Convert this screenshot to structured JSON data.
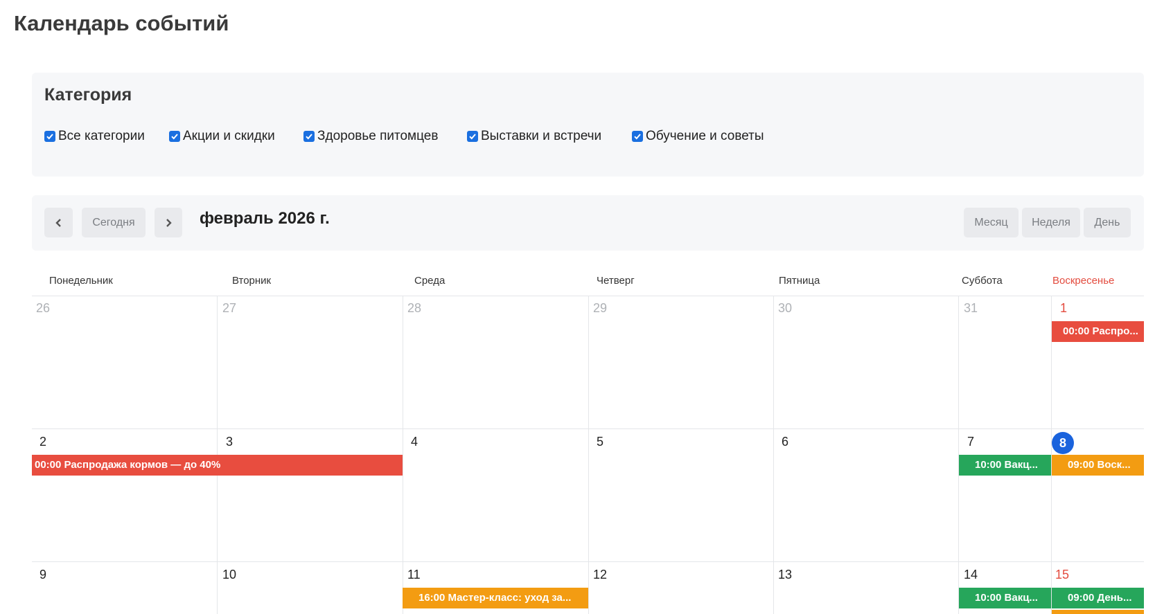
{
  "page": {
    "title": "Календарь событий"
  },
  "categories": {
    "title": "Категория",
    "options": [
      {
        "label": "Все категории",
        "checked": true
      },
      {
        "label": "Акции и скидки",
        "checked": true
      },
      {
        "label": "Здоровье питомцев",
        "checked": true
      },
      {
        "label": "Выставки и встречи",
        "checked": true
      },
      {
        "label": "Обучение и советы",
        "checked": true
      }
    ]
  },
  "toolbar": {
    "prev_icon": "chevron-left-icon",
    "next_icon": "chevron-right-icon",
    "today_label": "Сегодня",
    "month_title": "февраль 2026 г.",
    "views": [
      "Месяц",
      "Неделя",
      "День"
    ]
  },
  "calendar": {
    "weekdays": [
      "Понедельник",
      "Вторник",
      "Среда",
      "Четверг",
      "Пятница",
      "Суббота",
      "Воскресенье"
    ],
    "weeks": [
      [
        "26",
        "27",
        "28",
        "29",
        "30",
        "31",
        "1"
      ],
      [
        "2",
        "3",
        "4",
        "5",
        "6",
        "7",
        "8"
      ],
      [
        "9",
        "10",
        "11",
        "12",
        "13",
        "14",
        "15"
      ]
    ],
    "today": "8",
    "events": [
      {
        "text": "00:00 Распро...",
        "color": "#e84d3f"
      },
      {
        "text": "00:00 Распродажа кормов — до 40%",
        "color": "#e84d3f"
      },
      {
        "text": "10:00 Вакц...",
        "color": "#26a65b"
      },
      {
        "text": "09:00 Воск...",
        "color": "#f39c12"
      },
      {
        "text": "16:00 Мастер-класс: уход за...",
        "color": "#f39c12"
      },
      {
        "text": "10:00 Вакц...",
        "color": "#26a65b"
      },
      {
        "text": "09:00 День...",
        "color": "#26a65b"
      }
    ]
  },
  "colors": {
    "accent": "#1a63dd",
    "weekend": "#e34b3e",
    "sale": "#e84d3f",
    "health": "#26a65b",
    "events": "#f39c12"
  }
}
